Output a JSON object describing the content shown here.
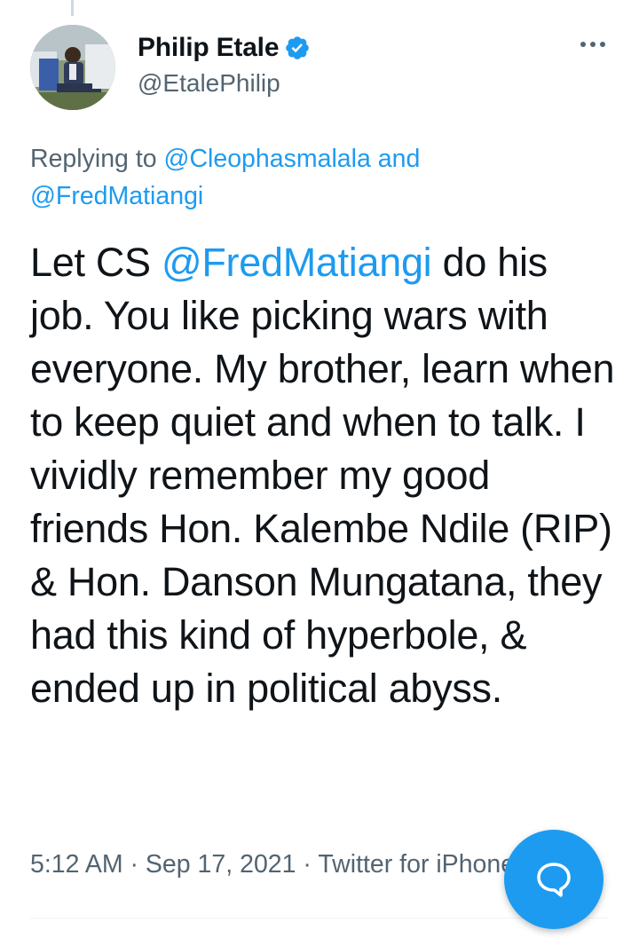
{
  "author": {
    "display_name": "Philip Etale",
    "handle": "@EtalePhilip",
    "verified": true
  },
  "reply_context": {
    "prefix": "Replying to",
    "mention1": "@Cleophasmalala",
    "conjunction": "and",
    "mention2": "@FredMatiangi"
  },
  "tweet": {
    "text_part1": "Let CS ",
    "mention": "@FredMatiangi",
    "text_part2": " do his job. You like picking wars with everyone. My brother, learn when to keep quiet and when to talk. I vividly remember my good friends Hon. Kalembe Ndile (RIP) & Hon. Danson Mungatana, they had this kind of hyperbole, & ended up in political abyss."
  },
  "meta": {
    "time": "5:12 AM",
    "separator": "·",
    "date": "Sep 17, 2021",
    "source": "Twitter for iPhone"
  },
  "icons": {
    "verified": "verified-badge-icon",
    "more": "more-options-icon",
    "compose": "chat-bubble-icon"
  },
  "colors": {
    "accent": "#1d9bf0",
    "text_primary": "#0f1419",
    "text_secondary": "#536471",
    "divider": "#eff3f4"
  }
}
